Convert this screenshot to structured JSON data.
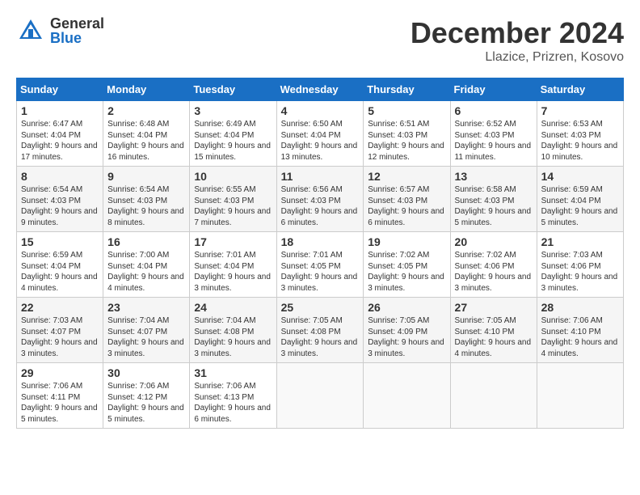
{
  "header": {
    "logo_general": "General",
    "logo_blue": "Blue",
    "month_title": "December 2024",
    "location": "Llazice, Prizren, Kosovo"
  },
  "days_of_week": [
    "Sunday",
    "Monday",
    "Tuesday",
    "Wednesday",
    "Thursday",
    "Friday",
    "Saturday"
  ],
  "weeks": [
    [
      {
        "day": "1",
        "sunrise": "6:47 AM",
        "sunset": "4:04 PM",
        "daylight": "9 hours and 17 minutes."
      },
      {
        "day": "2",
        "sunrise": "6:48 AM",
        "sunset": "4:04 PM",
        "daylight": "9 hours and 16 minutes."
      },
      {
        "day": "3",
        "sunrise": "6:49 AM",
        "sunset": "4:04 PM",
        "daylight": "9 hours and 15 minutes."
      },
      {
        "day": "4",
        "sunrise": "6:50 AM",
        "sunset": "4:04 PM",
        "daylight": "9 hours and 13 minutes."
      },
      {
        "day": "5",
        "sunrise": "6:51 AM",
        "sunset": "4:03 PM",
        "daylight": "9 hours and 12 minutes."
      },
      {
        "day": "6",
        "sunrise": "6:52 AM",
        "sunset": "4:03 PM",
        "daylight": "9 hours and 11 minutes."
      },
      {
        "day": "7",
        "sunrise": "6:53 AM",
        "sunset": "4:03 PM",
        "daylight": "9 hours and 10 minutes."
      }
    ],
    [
      {
        "day": "8",
        "sunrise": "6:54 AM",
        "sunset": "4:03 PM",
        "daylight": "9 hours and 9 minutes."
      },
      {
        "day": "9",
        "sunrise": "6:54 AM",
        "sunset": "4:03 PM",
        "daylight": "9 hours and 8 minutes."
      },
      {
        "day": "10",
        "sunrise": "6:55 AM",
        "sunset": "4:03 PM",
        "daylight": "9 hours and 7 minutes."
      },
      {
        "day": "11",
        "sunrise": "6:56 AM",
        "sunset": "4:03 PM",
        "daylight": "9 hours and 6 minutes."
      },
      {
        "day": "12",
        "sunrise": "6:57 AM",
        "sunset": "4:03 PM",
        "daylight": "9 hours and 6 minutes."
      },
      {
        "day": "13",
        "sunrise": "6:58 AM",
        "sunset": "4:03 PM",
        "daylight": "9 hours and 5 minutes."
      },
      {
        "day": "14",
        "sunrise": "6:59 AM",
        "sunset": "4:04 PM",
        "daylight": "9 hours and 5 minutes."
      }
    ],
    [
      {
        "day": "15",
        "sunrise": "6:59 AM",
        "sunset": "4:04 PM",
        "daylight": "9 hours and 4 minutes."
      },
      {
        "day": "16",
        "sunrise": "7:00 AM",
        "sunset": "4:04 PM",
        "daylight": "9 hours and 4 minutes."
      },
      {
        "day": "17",
        "sunrise": "7:01 AM",
        "sunset": "4:04 PM",
        "daylight": "9 hours and 3 minutes."
      },
      {
        "day": "18",
        "sunrise": "7:01 AM",
        "sunset": "4:05 PM",
        "daylight": "9 hours and 3 minutes."
      },
      {
        "day": "19",
        "sunrise": "7:02 AM",
        "sunset": "4:05 PM",
        "daylight": "9 hours and 3 minutes."
      },
      {
        "day": "20",
        "sunrise": "7:02 AM",
        "sunset": "4:06 PM",
        "daylight": "9 hours and 3 minutes."
      },
      {
        "day": "21",
        "sunrise": "7:03 AM",
        "sunset": "4:06 PM",
        "daylight": "9 hours and 3 minutes."
      }
    ],
    [
      {
        "day": "22",
        "sunrise": "7:03 AM",
        "sunset": "4:07 PM",
        "daylight": "9 hours and 3 minutes."
      },
      {
        "day": "23",
        "sunrise": "7:04 AM",
        "sunset": "4:07 PM",
        "daylight": "9 hours and 3 minutes."
      },
      {
        "day": "24",
        "sunrise": "7:04 AM",
        "sunset": "4:08 PM",
        "daylight": "9 hours and 3 minutes."
      },
      {
        "day": "25",
        "sunrise": "7:05 AM",
        "sunset": "4:08 PM",
        "daylight": "9 hours and 3 minutes."
      },
      {
        "day": "26",
        "sunrise": "7:05 AM",
        "sunset": "4:09 PM",
        "daylight": "9 hours and 3 minutes."
      },
      {
        "day": "27",
        "sunrise": "7:05 AM",
        "sunset": "4:10 PM",
        "daylight": "9 hours and 4 minutes."
      },
      {
        "day": "28",
        "sunrise": "7:06 AM",
        "sunset": "4:10 PM",
        "daylight": "9 hours and 4 minutes."
      }
    ],
    [
      {
        "day": "29",
        "sunrise": "7:06 AM",
        "sunset": "4:11 PM",
        "daylight": "9 hours and 5 minutes."
      },
      {
        "day": "30",
        "sunrise": "7:06 AM",
        "sunset": "4:12 PM",
        "daylight": "9 hours and 5 minutes."
      },
      {
        "day": "31",
        "sunrise": "7:06 AM",
        "sunset": "4:13 PM",
        "daylight": "9 hours and 6 minutes."
      },
      null,
      null,
      null,
      null
    ]
  ]
}
